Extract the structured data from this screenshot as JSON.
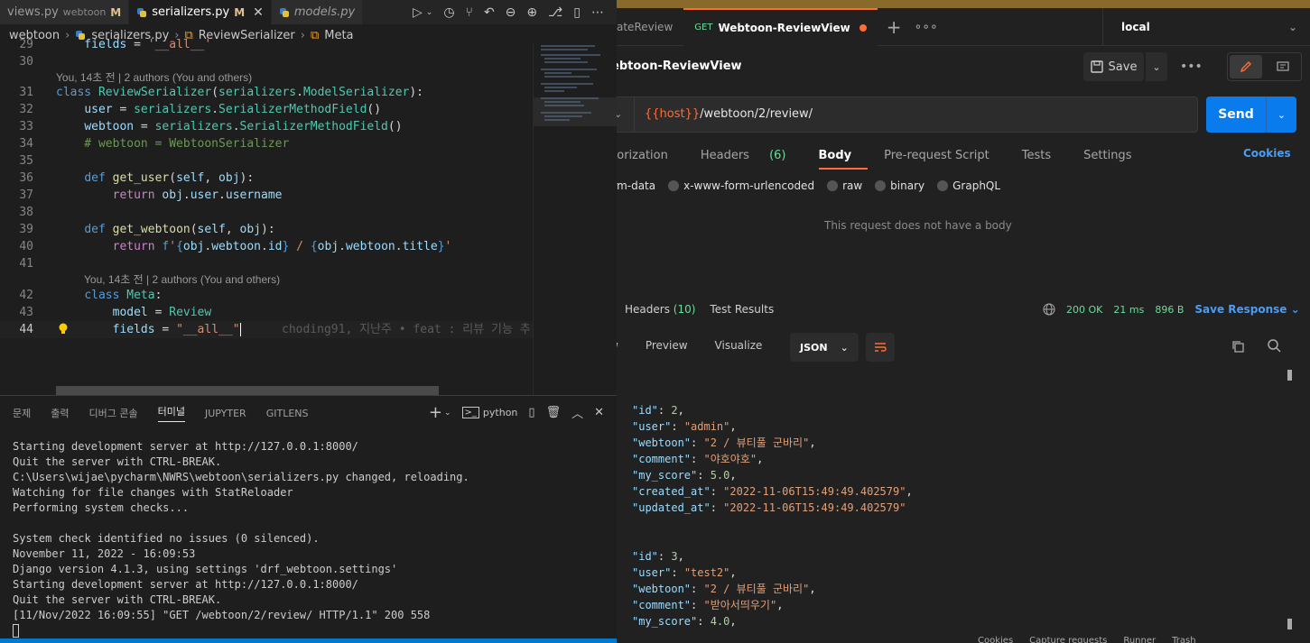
{
  "vscode": {
    "tabs": [
      {
        "label": "views.py",
        "desc": "webtoon",
        "mod": "M"
      },
      {
        "label": "serializers.py",
        "desc": "",
        "mod": "M"
      },
      {
        "label": "models.py",
        "desc": "",
        "mod": ""
      }
    ],
    "breadcrumb": [
      "webtoon",
      "serializers.py",
      "ReviewSerializer",
      "Meta"
    ],
    "code_lines": [
      {
        "n": "29",
        "html": "    fields = '__all__'"
      },
      {
        "n": "30",
        "html": ""
      },
      {
        "n": "31",
        "html": "class ReviewSerializer(serializers.ModelSerializer):"
      },
      {
        "n": "32",
        "html": "    user = serializers.SerializerMethodField()"
      },
      {
        "n": "33",
        "html": "    webtoon = serializers.SerializerMethodField()"
      },
      {
        "n": "34",
        "html": "    # webtoon = WebtoonSerializer"
      },
      {
        "n": "35",
        "html": ""
      },
      {
        "n": "36",
        "html": "    def get_user(self, obj):"
      },
      {
        "n": "37",
        "html": "        return obj.user.username"
      },
      {
        "n": "38",
        "html": ""
      },
      {
        "n": "39",
        "html": "    def get_webtoon(self, obj):"
      },
      {
        "n": "40",
        "html": "        return f'{obj.webtoon.id} / {obj.webtoon.title}'"
      },
      {
        "n": "41",
        "html": ""
      },
      {
        "n": "42",
        "html": "    class Meta:"
      },
      {
        "n": "43",
        "html": "        model = Review"
      },
      {
        "n": "44",
        "html": "        fields = \"__all__\""
      }
    ],
    "codelens_1": "You, 14초 전 | 2 authors (You and others)",
    "codelens_2": "You, 14초 전 | 2 authors (You and others)",
    "ghost_blame": "choding91, 지난주 • feat : 리뷰 기능 추",
    "panel_tabs": [
      "문제",
      "출력",
      "디버그 콘솔",
      "터미널",
      "JUPYTER",
      "GITLENS"
    ],
    "terminal_shell": "python",
    "terminal_lines": [
      "Starting development server at http://127.0.0.1:8000/",
      "Quit the server with CTRL-BREAK.",
      "C:\\Users\\wijae\\pycharm\\NWRS\\webtoon\\serializers.py changed, reloading.",
      "Watching for file changes with StatReloader",
      "Performing system checks...",
      "",
      "System check identified no issues (0 silenced).",
      "November 11, 2022 - 16:09:53",
      "Django version 4.1.3, using settings 'drf_webtoon.settings'",
      "Starting development server at http://127.0.0.1:8000/",
      "Quit the server with CTRL-BREAK.",
      "[11/Nov/2022 16:09:55] \"GET /webtoon/2/review/ HTTP/1.1\" 200 558"
    ]
  },
  "postman": {
    "tabs": [
      {
        "label": "ateReview",
        "method": ""
      },
      {
        "label": "Webtoon-ReviewView",
        "method": "GET"
      }
    ],
    "environment": "local",
    "request_title": "ebtoon-ReviewView",
    "save_label": "Save",
    "url_var": "{{host}}",
    "url_path": "/webtoon/2/review/",
    "send_label": "Send",
    "req_tabs": [
      {
        "label": "horization",
        "count": ""
      },
      {
        "label": "Headers",
        "count": "(6)"
      },
      {
        "label": "Body",
        "count": ""
      },
      {
        "label": "Pre-request Script",
        "count": ""
      },
      {
        "label": "Tests",
        "count": ""
      },
      {
        "label": "Settings",
        "count": ""
      }
    ],
    "cookies_label": "Cookies",
    "body_modes": [
      "orm-data",
      "x-www-form-urlencoded",
      "raw",
      "binary",
      "GraphQL"
    ],
    "no_body_text": "This request does not have a body",
    "resp_headers_label": "Headers",
    "resp_headers_count": "(10)",
    "resp_tests_label": "Test Results",
    "status": "200 OK",
    "time": "21 ms",
    "size": "896 B",
    "save_response": "Save Response",
    "view_tabs": [
      "w",
      "Preview",
      "Visualize"
    ],
    "format": "JSON",
    "json_records": [
      {
        "id": "2",
        "user": "\"admin\"",
        "webtoon": "\"2 / 뷰티풀 군바리\"",
        "comment": "\"야호야호\"",
        "my_score": "5.0",
        "created_at": "\"2022-11-06T15:49:49.402579\"",
        "updated_at": "\"2022-11-06T15:49:49.402579\""
      },
      {
        "id": "3",
        "user": "\"test2\"",
        "webtoon": "\"2 / 뷰티풀 군바리\"",
        "comment": "\"받아서띄우기\"",
        "my_score": "4.0"
      }
    ],
    "footer_items": [
      "Cookies",
      "Capture requests",
      "Runner",
      "Trash"
    ]
  }
}
